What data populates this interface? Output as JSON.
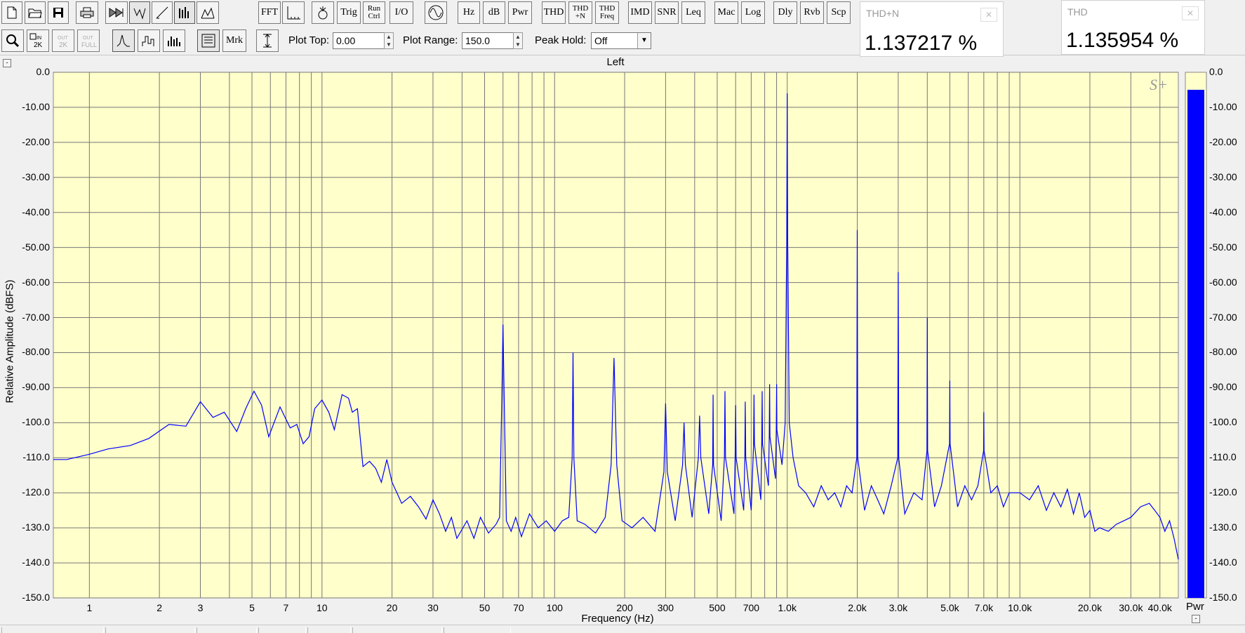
{
  "toolbar1": {
    "new_icon": "new-file-icon",
    "open_icon": "open-folder-icon",
    "save_icon": "save-icon",
    "print_icon": "print-icon",
    "fft": "FFT",
    "trig": "Trig",
    "run_ctrl_1": "Run",
    "run_ctrl_2": "Ctrl",
    "io": "I/O",
    "hz": "Hz",
    "db": "dB",
    "pwr": "Pwr",
    "thd": "THD",
    "thdn_1": "THD",
    "thdn_2": "+N",
    "thdf_1": "THD",
    "thdf_2": "Freq",
    "imd": "IMD",
    "snr": "SNR",
    "leq": "Leq",
    "mac": "Mac",
    "log": "Log",
    "dly": "Dly",
    "rvb": "Rvb",
    "scp": "Scp"
  },
  "toolbar2": {
    "mrk": "Mrk",
    "plot_top_label": "Plot Top:",
    "plot_top_value": "0.00",
    "plot_range_label": "Plot Range:",
    "plot_range_value": "150.0",
    "peak_hold_label": "Peak Hold:",
    "peak_hold_value": "Off"
  },
  "meters": {
    "thdn": {
      "title": "THD+N",
      "value": "1.137217 %"
    },
    "thd": {
      "title": "THD",
      "value": "1.135954 %"
    }
  },
  "colors": {
    "plot_bg": "#ffffcc",
    "trace": "#0000ff",
    "grid": "#777777",
    "bar": "#0000ff"
  },
  "chart_data": {
    "type": "line",
    "title": "Left",
    "xlabel": "Frequency (Hz)",
    "ylabel": "Relative Amplitude (dBFS)",
    "x_scale": "log",
    "xlim": [
      0.7,
      48000
    ],
    "ylim": [
      -150,
      0
    ],
    "grid": true,
    "y_ticks": [
      "0.0",
      "-10.00",
      "-20.00",
      "-30.00",
      "-40.00",
      "-50.00",
      "-60.00",
      "-70.00",
      "-80.00",
      "-90.00",
      "-100.0",
      "-110.0",
      "-120.0",
      "-130.0",
      "-140.0",
      "-150.0"
    ],
    "x_ticks": [
      {
        "v": 1,
        "l": "1"
      },
      {
        "v": 2,
        "l": "2"
      },
      {
        "v": 3,
        "l": "3"
      },
      {
        "v": 5,
        "l": "5"
      },
      {
        "v": 7,
        "l": "7"
      },
      {
        "v": 10,
        "l": "10"
      },
      {
        "v": 20,
        "l": "20"
      },
      {
        "v": 30,
        "l": "30"
      },
      {
        "v": 50,
        "l": "50"
      },
      {
        "v": 70,
        "l": "70"
      },
      {
        "v": 100,
        "l": "100"
      },
      {
        "v": 200,
        "l": "200"
      },
      {
        "v": 300,
        "l": "300"
      },
      {
        "v": 500,
        "l": "500"
      },
      {
        "v": 700,
        "l": "700"
      },
      {
        "v": 1000,
        "l": "1.0k"
      },
      {
        "v": 2000,
        "l": "2.0k"
      },
      {
        "v": 3000,
        "l": "3.0k"
      },
      {
        "v": 5000,
        "l": "5.0k"
      },
      {
        "v": 7000,
        "l": "7.0k"
      },
      {
        "v": 10000,
        "l": "10.0k"
      },
      {
        "v": 20000,
        "l": "20.0k"
      },
      {
        "v": 30000,
        "l": "30.0k"
      },
      {
        "v": 40000,
        "l": "40.0k"
      }
    ],
    "series": [
      {
        "points": [
          [
            0.7,
            -110.5
          ],
          [
            0.8,
            -110.5
          ],
          [
            1,
            -109
          ],
          [
            1.2,
            -107.5
          ],
          [
            1.5,
            -106.5
          ],
          [
            1.8,
            -104.5
          ],
          [
            2.2,
            -100.5
          ],
          [
            2.6,
            -101
          ],
          [
            3,
            -94
          ],
          [
            3.4,
            -98.5
          ],
          [
            3.8,
            -97
          ],
          [
            4.3,
            -102.5
          ],
          [
            4.7,
            -96
          ],
          [
            5.1,
            -91
          ],
          [
            5.5,
            -95
          ],
          [
            5.9,
            -104
          ],
          [
            6.6,
            -95.5
          ],
          [
            7.3,
            -101.5
          ],
          [
            7.8,
            -100.5
          ],
          [
            8.3,
            -106
          ],
          [
            8.8,
            -104
          ],
          [
            9.3,
            -96
          ],
          [
            10,
            -93.5
          ],
          [
            10.7,
            -97
          ],
          [
            11.3,
            -102
          ],
          [
            12.2,
            -92
          ],
          [
            13,
            -93
          ],
          [
            13.5,
            -97
          ],
          [
            14.2,
            -96
          ],
          [
            15,
            -112.5
          ],
          [
            16,
            -111
          ],
          [
            17,
            -113
          ],
          [
            18,
            -117
          ],
          [
            19,
            -110.5
          ],
          [
            20,
            -117
          ],
          [
            21,
            -120
          ],
          [
            22,
            -123
          ],
          [
            24,
            -121
          ],
          [
            26,
            -124
          ],
          [
            28,
            -127.5
          ],
          [
            30,
            -122
          ],
          [
            32,
            -126
          ],
          [
            34,
            -131
          ],
          [
            36,
            -127
          ],
          [
            38,
            -133
          ],
          [
            42,
            -128
          ],
          [
            45,
            -133
          ],
          [
            48,
            -127
          ],
          [
            52,
            -131.5
          ],
          [
            56,
            -129
          ],
          [
            58,
            -127
          ],
          [
            59.5,
            -88
          ],
          [
            60,
            -72
          ],
          [
            60.5,
            -87
          ],
          [
            62,
            -128
          ],
          [
            65,
            -131
          ],
          [
            68,
            -127
          ],
          [
            72,
            -132.5
          ],
          [
            78,
            -126
          ],
          [
            85,
            -130
          ],
          [
            92,
            -128
          ],
          [
            100,
            -131
          ],
          [
            108,
            -128
          ],
          [
            115,
            -127
          ],
          [
            119,
            -110
          ],
          [
            120,
            -80
          ],
          [
            121,
            -110
          ],
          [
            125,
            -128
          ],
          [
            135,
            -129
          ],
          [
            150,
            -131.5
          ],
          [
            165,
            -127
          ],
          [
            175,
            -112
          ],
          [
            180,
            -81.5
          ],
          [
            185,
            -112
          ],
          [
            195,
            -128
          ],
          [
            215,
            -130
          ],
          [
            240,
            -127
          ],
          [
            270,
            -131
          ],
          [
            295,
            -114
          ],
          [
            300,
            -94.5
          ],
          [
            305,
            -114
          ],
          [
            330,
            -128
          ],
          [
            355,
            -112
          ],
          [
            360,
            -100
          ],
          [
            365,
            -112
          ],
          [
            390,
            -127
          ],
          [
            415,
            -110
          ],
          [
            420,
            -98
          ],
          [
            425,
            -110
          ],
          [
            460,
            -126
          ],
          [
            478,
            -112
          ],
          [
            480,
            -92
          ],
          [
            482,
            -112
          ],
          [
            520,
            -128
          ],
          [
            537,
            -110
          ],
          [
            540,
            -91
          ],
          [
            543,
            -110
          ],
          [
            590,
            -126
          ],
          [
            597,
            -110
          ],
          [
            600,
            -95
          ],
          [
            603,
            -110
          ],
          [
            650,
            -125
          ],
          [
            657,
            -110
          ],
          [
            660,
            -94
          ],
          [
            663,
            -110
          ],
          [
            700,
            -125
          ],
          [
            717,
            -106
          ],
          [
            720,
            -92
          ],
          [
            723,
            -106
          ],
          [
            770,
            -122
          ],
          [
            777,
            -106
          ],
          [
            780,
            -91
          ],
          [
            783,
            -106
          ],
          [
            830,
            -118
          ],
          [
            837,
            -104
          ],
          [
            840,
            -89
          ],
          [
            843,
            -104
          ],
          [
            890,
            -116
          ],
          [
            897,
            -102
          ],
          [
            900,
            -89
          ],
          [
            903,
            -102
          ],
          [
            950,
            -112
          ],
          [
            980,
            -100
          ],
          [
            995,
            -48
          ],
          [
            1000,
            -6
          ],
          [
            1005,
            -48
          ],
          [
            1020,
            -100
          ],
          [
            1060,
            -110
          ],
          [
            1120,
            -118
          ],
          [
            1200,
            -120
          ],
          [
            1300,
            -124
          ],
          [
            1400,
            -118
          ],
          [
            1500,
            -122
          ],
          [
            1600,
            -120
          ],
          [
            1700,
            -124
          ],
          [
            1800,
            -118
          ],
          [
            1900,
            -120
          ],
          [
            1990,
            -110
          ],
          [
            2000,
            -45
          ],
          [
            2010,
            -110
          ],
          [
            2150,
            -125
          ],
          [
            2300,
            -118
          ],
          [
            2450,
            -122
          ],
          [
            2600,
            -126
          ],
          [
            2800,
            -118
          ],
          [
            2985,
            -110
          ],
          [
            3000,
            -57
          ],
          [
            3015,
            -110
          ],
          [
            3200,
            -126
          ],
          [
            3500,
            -120
          ],
          [
            3800,
            -122
          ],
          [
            3985,
            -108
          ],
          [
            4000,
            -70
          ],
          [
            4015,
            -108
          ],
          [
            4300,
            -124
          ],
          [
            4600,
            -118
          ],
          [
            4985,
            -106
          ],
          [
            5000,
            -88
          ],
          [
            5015,
            -106
          ],
          [
            5400,
            -124
          ],
          [
            5800,
            -118
          ],
          [
            6200,
            -122
          ],
          [
            6600,
            -118
          ],
          [
            6985,
            -108
          ],
          [
            7000,
            -97
          ],
          [
            7015,
            -108
          ],
          [
            7500,
            -120
          ],
          [
            8000,
            -118
          ],
          [
            8500,
            -124
          ],
          [
            9000,
            -120
          ],
          [
            10000,
            -120
          ],
          [
            11000,
            -122
          ],
          [
            12000,
            -118
          ],
          [
            13000,
            -125
          ],
          [
            14000,
            -120
          ],
          [
            15000,
            -124
          ],
          [
            16000,
            -119
          ],
          [
            17000,
            -126
          ],
          [
            18000,
            -120
          ],
          [
            19000,
            -127
          ],
          [
            20000,
            -125
          ],
          [
            21000,
            -131
          ],
          [
            22000,
            -130
          ],
          [
            24000,
            -131
          ],
          [
            26000,
            -129
          ],
          [
            28000,
            -128
          ],
          [
            30000,
            -127
          ],
          [
            33000,
            -124
          ],
          [
            36000,
            -123
          ],
          [
            38000,
            -125
          ],
          [
            40000,
            -127
          ],
          [
            42000,
            -131
          ],
          [
            44000,
            -128
          ],
          [
            46000,
            -133
          ],
          [
            48000,
            -139
          ]
        ]
      }
    ]
  },
  "level_bar": {
    "label": "Pwr",
    "level_db": -5.0,
    "ticks": [
      "0.0",
      "-10.00",
      "-20.00",
      "-30.00",
      "-40.00",
      "-50.00",
      "-60.00",
      "-70.00",
      "-80.00",
      "-90.00",
      "-100.0",
      "-110.0",
      "-120.0",
      "-130.0",
      "-140.0",
      "-150.0"
    ]
  }
}
